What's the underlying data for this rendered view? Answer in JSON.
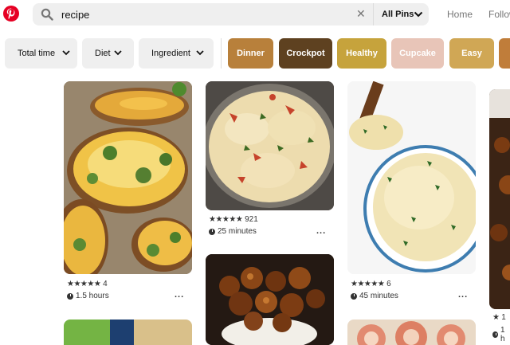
{
  "header": {
    "logo_icon": "pinterest-logo",
    "search_value": "recipe",
    "search_icon": "search-icon",
    "clear_icon": "close-icon",
    "clear_glyph": "✕",
    "scope_label": "All Pins",
    "nav_home": "Home",
    "nav_following": "Follow"
  },
  "filters": [
    {
      "label": "Total time"
    },
    {
      "label": "Diet"
    },
    {
      "label": "Ingredient"
    }
  ],
  "chips": [
    {
      "label": "Dinner",
      "color": "#b8803b"
    },
    {
      "label": "Crockpot",
      "color": "#5e4120"
    },
    {
      "label": "Healthy",
      "color": "#c6a33c"
    },
    {
      "label": "Cupcake",
      "color": "#e8c5b8"
    },
    {
      "label": "Easy",
      "color": "#d0a755"
    }
  ],
  "pins": [
    {
      "stars": "★★★★★",
      "rating_count": "4",
      "time": "1.5 hours",
      "more": "..."
    },
    {
      "stars": "★★★★★",
      "rating_count": "921",
      "time": "25 minutes",
      "more": "..."
    },
    {
      "stars": "★★★★★",
      "rating_count": "6",
      "time": "45 minutes",
      "more": "..."
    },
    {
      "stars": "★",
      "rating_count": "1",
      "time": "1 h",
      "more": ""
    }
  ]
}
